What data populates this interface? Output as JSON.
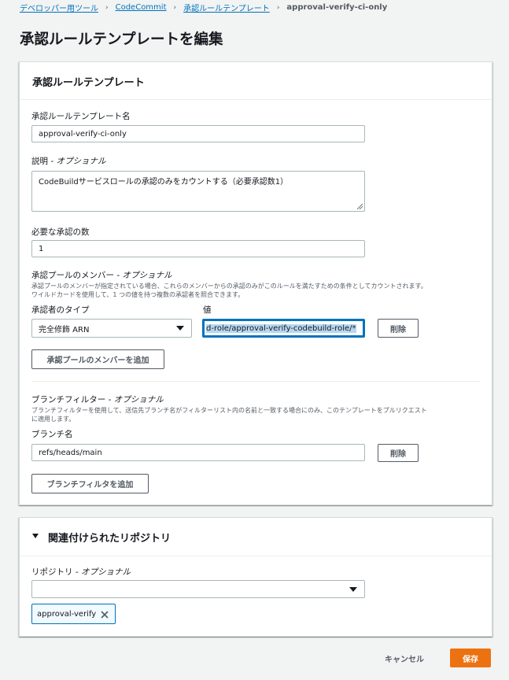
{
  "breadcrumb": {
    "items": [
      "デベロッパー用ツール",
      "CodeCommit",
      "承認ルールテンプレート"
    ],
    "current": "approval-verify-ci-only"
  },
  "page": {
    "title": "承認ルールテンプレートを編集"
  },
  "template_panel": {
    "title": "承認ルールテンプレート",
    "name_label": "承認ルールテンプレート名",
    "name_value": "approval-verify-ci-only",
    "description_label": "説明",
    "description_optional": "- オプショナル",
    "description_value": "CodeBuildサービスロールの承認のみをカウントする（必要承認数1）",
    "approvals_label": "必要な承認の数",
    "approvals_value": "1",
    "pool": {
      "label": "承認プールのメンバー",
      "optional": "- オプショナル",
      "desc_line1": "承認プールのメンバーが指定されている場合、これらのメンバーからの承認のみがこのルールを満たすための条件としてカウントされます。",
      "desc_line2": "ワイルドカードを使用して、1 つの値を持つ複数の承認者を照合できます。",
      "type_label": "承認者のタイプ",
      "value_label": "値",
      "type_value": "完全修飾 ARN",
      "member_value": "d-role/approval-verify-codebuild-role/*",
      "delete_label": "削除",
      "add_label": "承認プールのメンバーを追加"
    },
    "branch": {
      "label": "ブランチフィルター",
      "optional": "- オプショナル",
      "desc_line1": "ブランチフィルターを使用して、送信先ブランチ名がフィルターリスト内の名前と一致する場合にのみ、このテンプレートをプルリクエスト",
      "desc_line2": "に適用します。",
      "name_label": "ブランチ名",
      "name_value": "refs/heads/main",
      "delete_label": "削除",
      "add_label": "ブランチフィルタを追加"
    }
  },
  "repo_panel": {
    "title": "関連付けられたリポジトリ",
    "repo_label": "リポジトリ",
    "repo_optional": "- オプショナル",
    "select_value": "",
    "token": "approval-verify"
  },
  "footer": {
    "cancel_label": "キャンセル",
    "save_label": "保存"
  },
  "colors": {
    "link": "#0073bb",
    "primary": "#ec7211",
    "border": "#aab7b8",
    "focus": "#0073bb"
  },
  "icons": [
    "chevron-right-icon",
    "dropdown-arrow-icon",
    "collapse-caret-icon",
    "close-icon",
    "resize-handle-icon"
  ]
}
